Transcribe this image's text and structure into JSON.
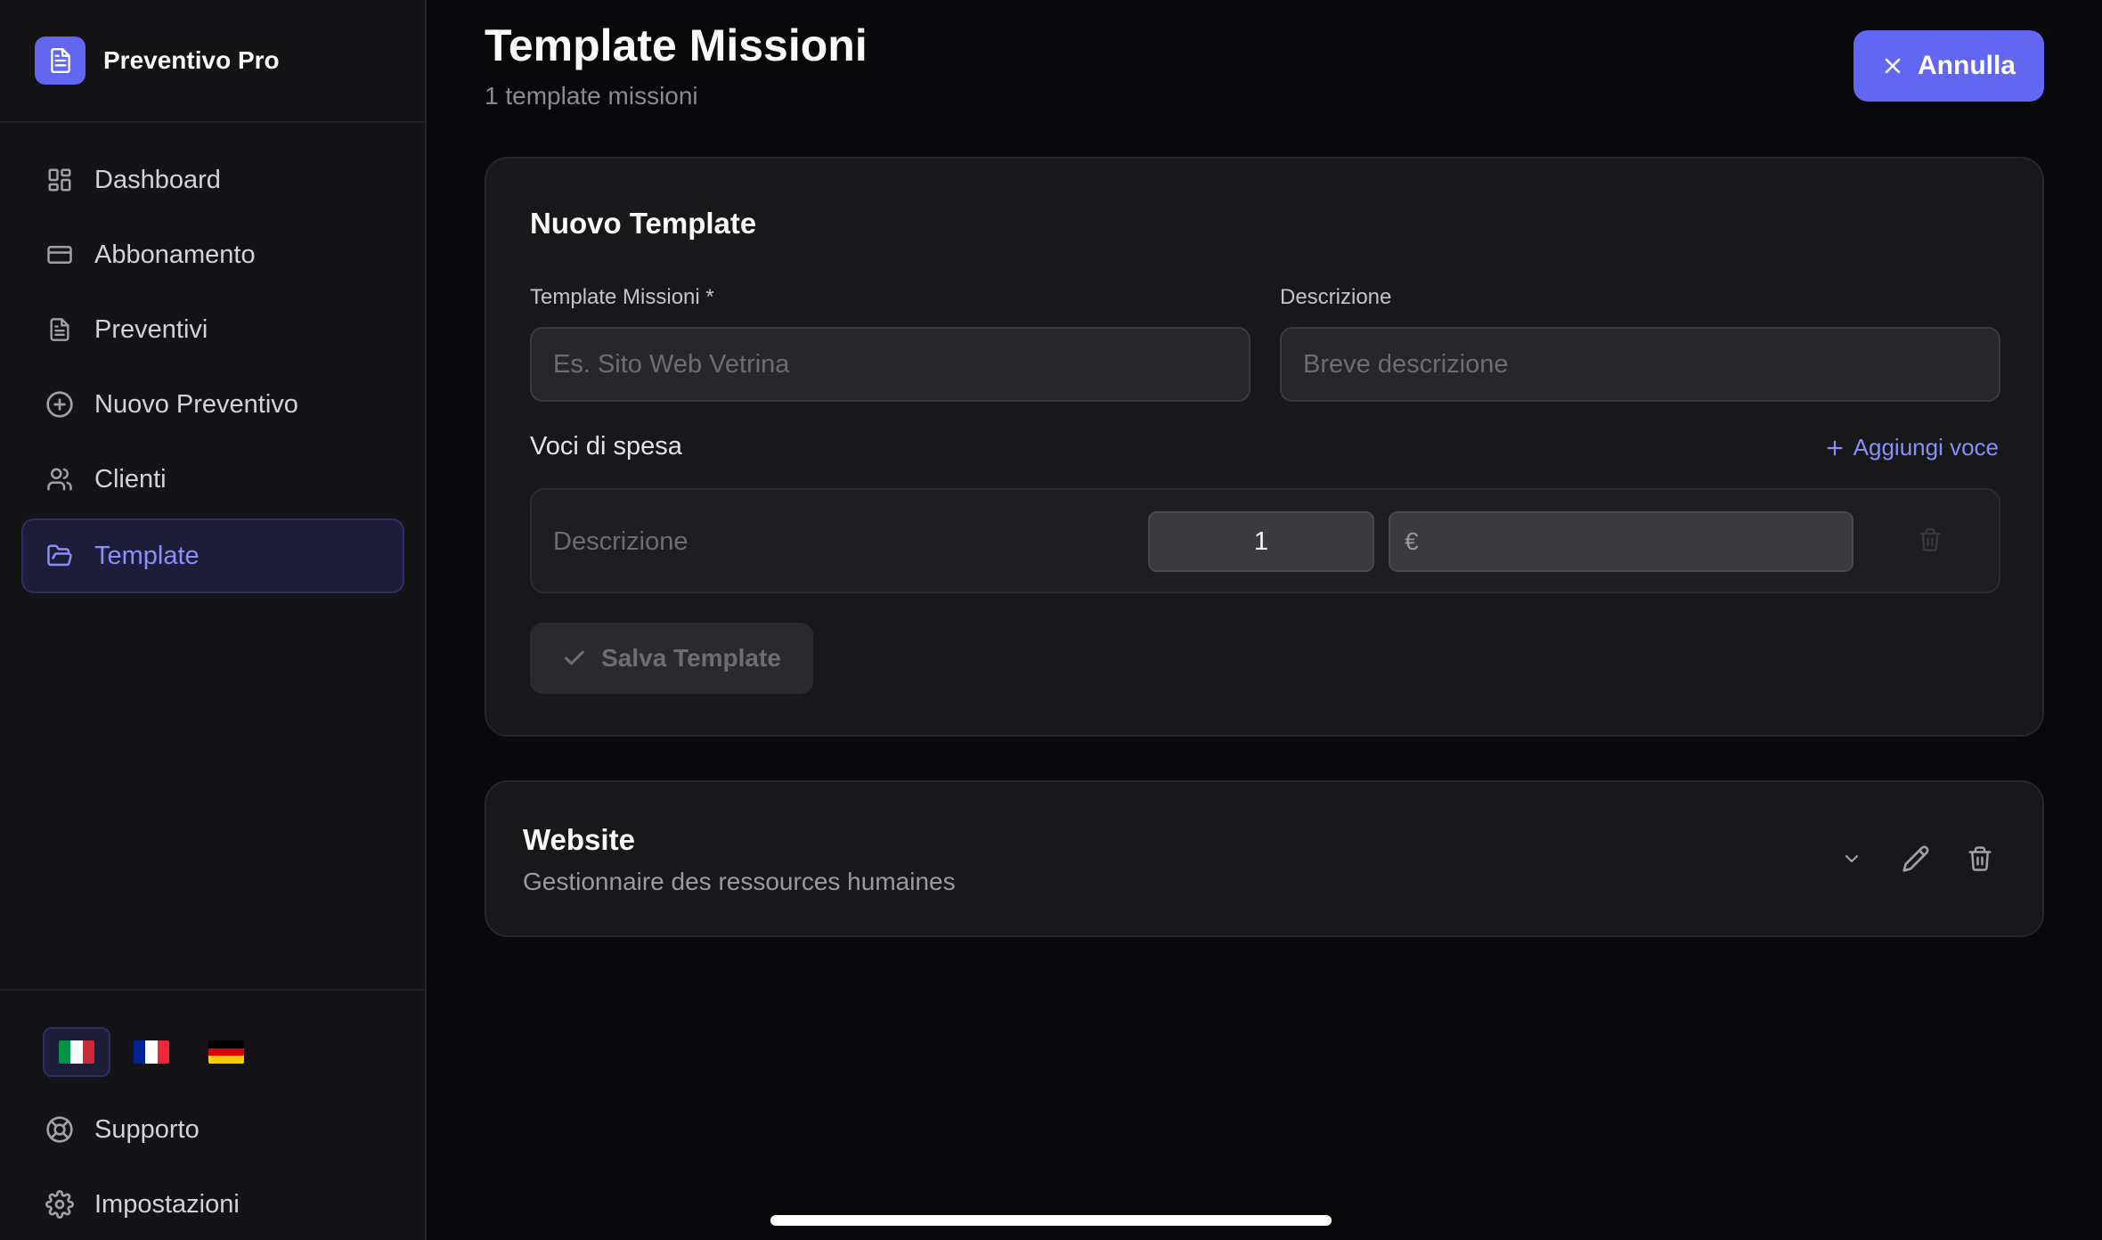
{
  "app": {
    "name": "Preventivo Pro",
    "accent": "#6366f1"
  },
  "sidebar": {
    "items": [
      {
        "label": "Dashboard",
        "icon": "dashboard-icon"
      },
      {
        "label": "Abbonamento",
        "icon": "credit-card-icon"
      },
      {
        "label": "Preventivi",
        "icon": "document-icon"
      },
      {
        "label": "Nuovo Preventivo",
        "icon": "plus-circle-icon"
      },
      {
        "label": "Clienti",
        "icon": "users-icon"
      },
      {
        "label": "Template",
        "icon": "folder-open-icon",
        "active": true
      }
    ],
    "languages": [
      {
        "code": "it",
        "active": true
      },
      {
        "code": "fr",
        "active": false
      },
      {
        "code": "de",
        "active": false
      }
    ],
    "bottom_items": [
      {
        "label": "Supporto",
        "icon": "lifebuoy-icon"
      },
      {
        "label": "Impostazioni",
        "icon": "gear-icon"
      }
    ]
  },
  "header": {
    "title": "Template Missioni",
    "subtitle": "1 template missioni",
    "cancel_label": "Annulla"
  },
  "form": {
    "title": "Nuovo Template",
    "name_label": "Template Missioni *",
    "name_placeholder": "Es. Sito Web Vetrina",
    "description_label": "Descrizione",
    "description_placeholder": "Breve descrizione",
    "expenses_label": "Voci di spesa",
    "add_item_label": "Aggiungi voce",
    "row": {
      "description_placeholder": "Descrizione",
      "quantity": "1",
      "price_prefix": "€"
    },
    "save_label": "Salva Template"
  },
  "templates": [
    {
      "title": "Website",
      "description": "Gestionnaire des ressources humaines"
    }
  ]
}
